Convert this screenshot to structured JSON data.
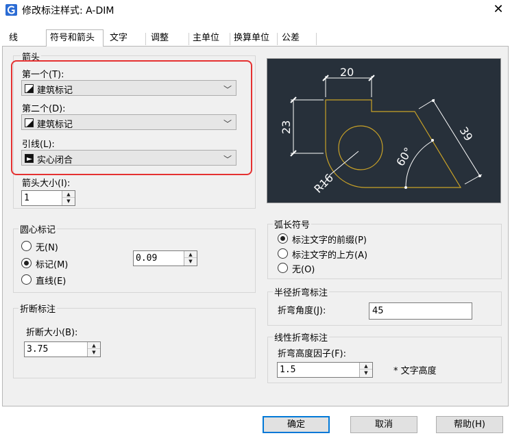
{
  "window": {
    "title": "修改标注样式: A-DIM",
    "close_label": "✕"
  },
  "tabs": [
    {
      "label": "线"
    },
    {
      "label": "符号和箭头"
    },
    {
      "label": "文字"
    },
    {
      "label": "调整"
    },
    {
      "label": "主单位"
    },
    {
      "label": "换算单位"
    },
    {
      "label": "公差"
    }
  ],
  "arrows": {
    "group_label": "箭头",
    "first_label": "第一个(T):",
    "first_value": "建筑标记",
    "second_label": "第二个(D):",
    "second_value": "建筑标记",
    "leader_label": "引线(L):",
    "leader_value": "实心闭合",
    "size_label": "箭头大小(I):",
    "size_value": "1"
  },
  "center_mark": {
    "group_label": "圆心标记",
    "options": [
      "无(N)",
      "标记(M)",
      "直线(E)"
    ],
    "selected": "标记(M)",
    "size_value": "0.09"
  },
  "break_dim": {
    "group_label": "折断标注",
    "size_label": "折断大小(B):",
    "size_value": "3.75"
  },
  "arc_symbol": {
    "group_label": "弧长符号",
    "options": [
      "标注文字的前缀(P)",
      "标注文字的上方(A)",
      "无(O)"
    ],
    "selected": "标注文字的前缀(P)"
  },
  "radius_jog": {
    "group_label": "半径折弯标注",
    "angle_label": "折弯角度(J):",
    "angle_value": "45"
  },
  "linear_jog": {
    "group_label": "线性折弯标注",
    "factor_label": "折弯高度因子(F):",
    "factor_value": "1.5",
    "suffix": "* 文字高度"
  },
  "preview": {
    "dims": [
      "20",
      "23",
      "39",
      "60°",
      "R16"
    ],
    "colors": {
      "background": "#27303a",
      "shape": "#c9a227",
      "dims": "#ffffff"
    }
  },
  "buttons": {
    "ok": "确定",
    "cancel": "取消",
    "help": "帮助(H)"
  }
}
